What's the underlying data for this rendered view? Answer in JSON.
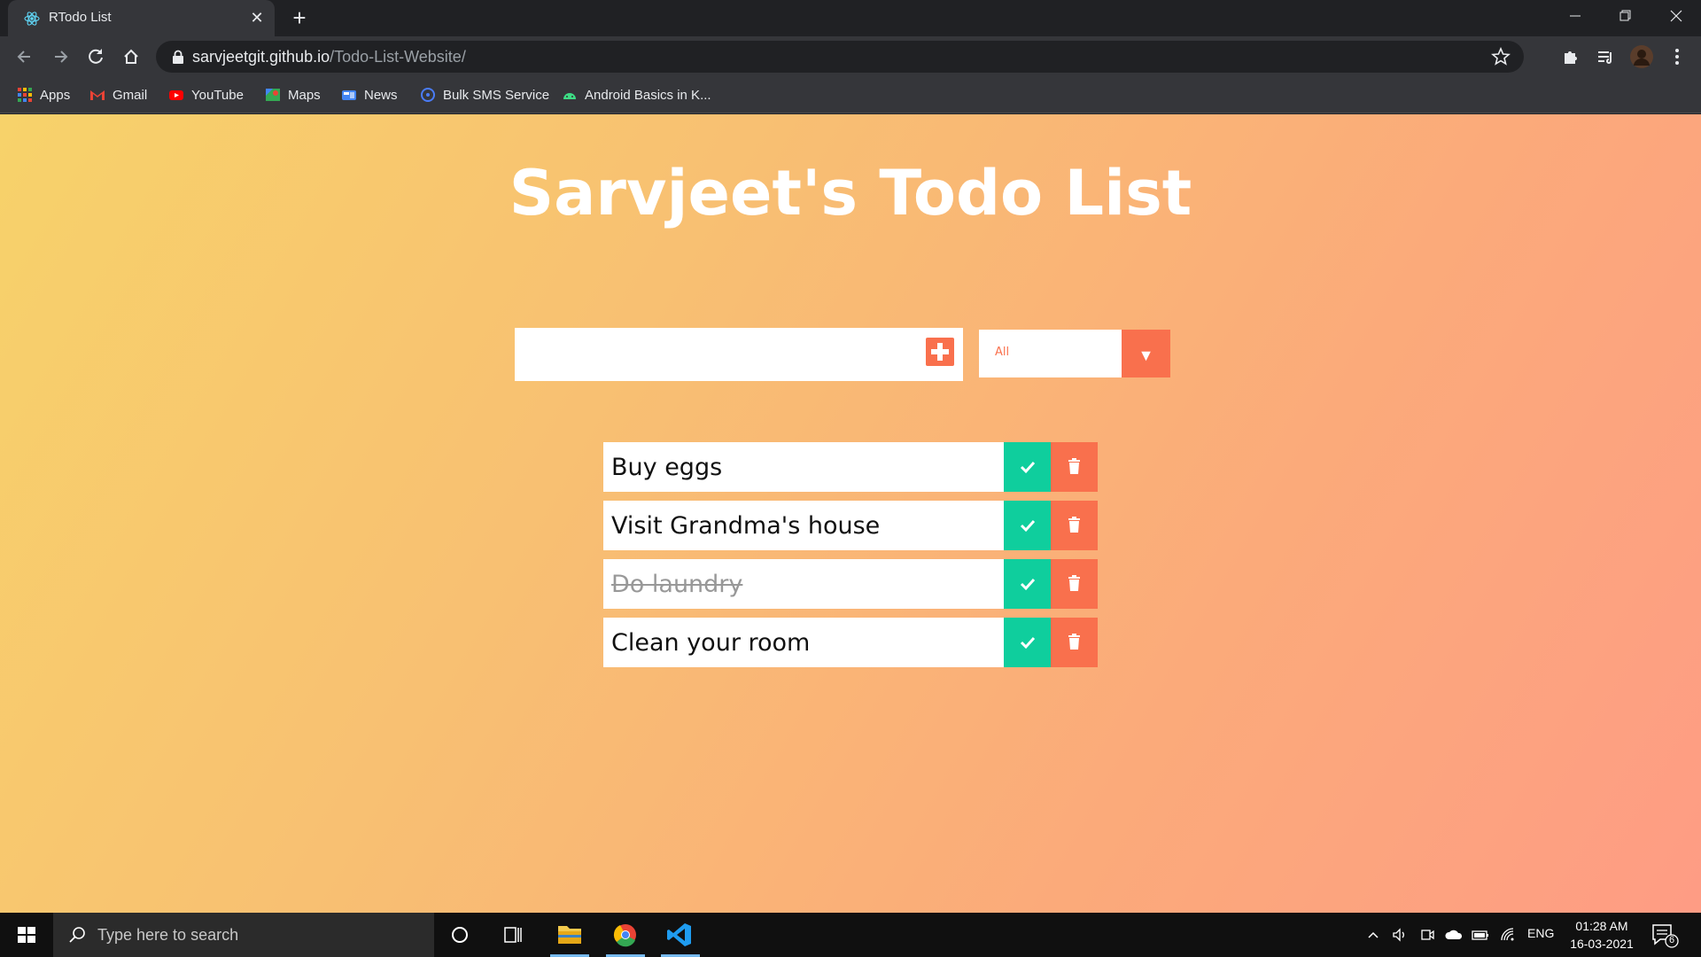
{
  "browser": {
    "tab_title": "RTodo List",
    "url_host": "sarvjeetgit.github.io",
    "url_path": "/Todo-List-Website/",
    "bookmarks": [
      {
        "label": "Apps",
        "icon": "apps-grid-icon"
      },
      {
        "label": "Gmail",
        "icon": "gmail-icon"
      },
      {
        "label": "YouTube",
        "icon": "youtube-icon"
      },
      {
        "label": "Maps",
        "icon": "maps-icon"
      },
      {
        "label": "News",
        "icon": "news-icon"
      },
      {
        "label": "Bulk SMS Service",
        "icon": "bulk-sms-icon"
      },
      {
        "label": "Android Basics in K...",
        "icon": "android-icon"
      }
    ]
  },
  "page": {
    "title": "Sarvjeet's Todo List",
    "filter_selected": "All",
    "todos": [
      {
        "text": "Buy eggs",
        "completed": false
      },
      {
        "text": "Visit Grandma's house",
        "completed": false
      },
      {
        "text": "Do laundry",
        "completed": true
      },
      {
        "text": "Clean your room",
        "completed": false
      }
    ]
  },
  "taskbar": {
    "search_placeholder": "Type here to search",
    "language": "ENG",
    "time": "01:28 AM",
    "date": "16-03-2021",
    "notification_count": "6"
  },
  "colors": {
    "accent_orange": "#f9704d",
    "accent_green": "#0fce9d",
    "gradient_start": "#f7d26a",
    "gradient_end": "#fe9c84"
  }
}
